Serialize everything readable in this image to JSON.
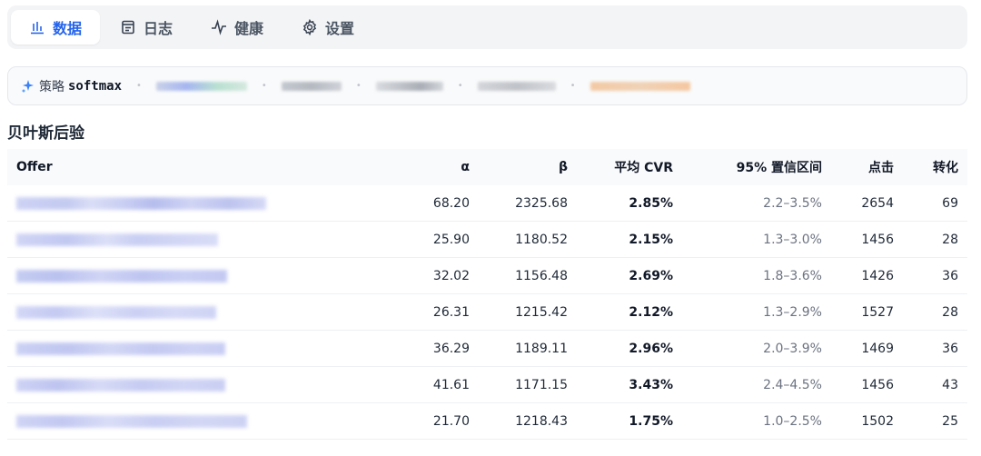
{
  "tabs": [
    {
      "label": "数据",
      "icon": "bar-chart-icon",
      "active": true
    },
    {
      "label": "日志",
      "icon": "log-icon",
      "active": false
    },
    {
      "label": "健康",
      "icon": "pulse-icon",
      "active": false
    },
    {
      "label": "设置",
      "icon": "gear-icon",
      "active": false
    }
  ],
  "strategy": {
    "label": "策略",
    "value": "softmax",
    "icon": "sparkle-icon"
  },
  "section_title": "贝叶斯后验",
  "table": {
    "headers": {
      "offer": "Offer",
      "alpha": "α",
      "beta": "β",
      "cvr": "平均 CVR",
      "ci": "95% 置信区间",
      "clicks": "点击",
      "conversions": "转化"
    },
    "rows": [
      {
        "alpha": "68.20",
        "beta": "2325.68",
        "cvr": "2.85%",
        "ci": "2.2–3.5%",
        "clicks": "2654",
        "conversions": "69"
      },
      {
        "alpha": "25.90",
        "beta": "1180.52",
        "cvr": "2.15%",
        "ci": "1.3–3.0%",
        "clicks": "1456",
        "conversions": "28"
      },
      {
        "alpha": "32.02",
        "beta": "1156.48",
        "cvr": "2.69%",
        "ci": "1.8–3.6%",
        "clicks": "1426",
        "conversions": "36"
      },
      {
        "alpha": "26.31",
        "beta": "1215.42",
        "cvr": "2.12%",
        "ci": "1.3–2.9%",
        "clicks": "1527",
        "conversions": "28"
      },
      {
        "alpha": "36.29",
        "beta": "1189.11",
        "cvr": "2.96%",
        "ci": "2.0–3.9%",
        "clicks": "1469",
        "conversions": "36"
      },
      {
        "alpha": "41.61",
        "beta": "1171.15",
        "cvr": "3.43%",
        "ci": "2.4–4.5%",
        "clicks": "1456",
        "conversions": "43"
      },
      {
        "alpha": "21.70",
        "beta": "1218.43",
        "cvr": "1.75%",
        "ci": "1.0–2.5%",
        "clicks": "1502",
        "conversions": "25"
      }
    ]
  },
  "colors": {
    "accent": "#2563eb",
    "blur_offer": "#c7cdf5"
  }
}
